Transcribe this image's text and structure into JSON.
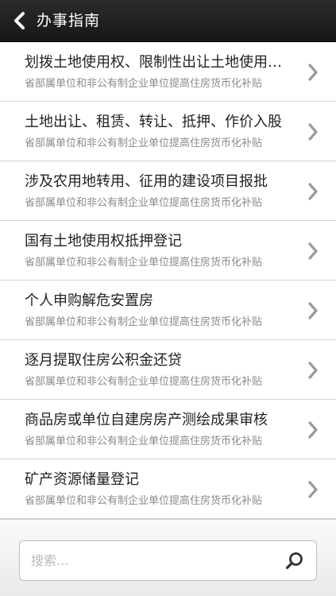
{
  "header": {
    "back_icon": "chevron-left-icon",
    "title": "办事指南"
  },
  "list": {
    "chevron_icon": "chevron-right-icon",
    "items": [
      {
        "title": "划拨土地使用权、限制性出让土地使用权转让",
        "subtitle": "省部属单位和非公有制企业单位提高住房货币化补贴"
      },
      {
        "title": "土地出让、租赁、转让、抵押、作价入股",
        "subtitle": "省部属单位和非公有制企业单位提高住房货币化补贴"
      },
      {
        "title": "涉及农用地转用、征用的建设项目报批",
        "subtitle": "省部属单位和非公有制企业单位提高住房货币化补贴"
      },
      {
        "title": "国有土地使用权抵押登记",
        "subtitle": "省部属单位和非公有制企业单位提高住房货币化补贴"
      },
      {
        "title": "个人申购解危安置房",
        "subtitle": "省部属单位和非公有制企业单位提高住房货币化补贴"
      },
      {
        "title": "逐月提取住房公积金还贷",
        "subtitle": "省部属单位和非公有制企业单位提高住房货币化补贴"
      },
      {
        "title": "商品房或单位自建房房产测绘成果审核",
        "subtitle": "省部属单位和非公有制企业单位提高住房货币化补贴"
      },
      {
        "title": "矿产资源储量登记",
        "subtitle": "省部属单位和非公有制企业单位提高住房货币化补贴"
      }
    ]
  },
  "search": {
    "placeholder": "搜索...",
    "value": "",
    "icon": "search-icon"
  },
  "colors": {
    "header_bg": "#1e1e1e",
    "title_text": "#222222",
    "subtitle_text": "#8a8a8a",
    "chevron": "#9a9a9a",
    "divider": "#d6d6d6"
  }
}
